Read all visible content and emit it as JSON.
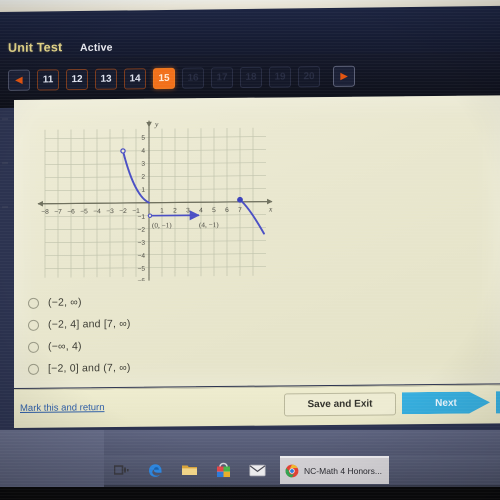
{
  "header": {
    "title": "Unit Test",
    "status": "Active",
    "prev_icon": "left-arrow-icon",
    "next_icon": "right-arrow-icon",
    "pager": [
      {
        "label": "11",
        "state": "normal"
      },
      {
        "label": "12",
        "state": "normal"
      },
      {
        "label": "13",
        "state": "normal"
      },
      {
        "label": "14",
        "state": "normal"
      },
      {
        "label": "15",
        "state": "current"
      },
      {
        "label": "16",
        "state": "disabled"
      },
      {
        "label": "17",
        "state": "disabled"
      },
      {
        "label": "18",
        "state": "disabled"
      },
      {
        "label": "19",
        "state": "disabled"
      },
      {
        "label": "20",
        "state": "disabled"
      }
    ],
    "colors": {
      "title": "#e8d98a",
      "current_button": "#f2701a",
      "button_border": "#7a3a1c",
      "background": "#161c33"
    }
  },
  "chart_data": {
    "type": "line",
    "title": "",
    "xlabel": "x",
    "ylabel": "y",
    "xlim": [
      -8.6,
      8.0
    ],
    "ylim": [
      -6.5,
      5.6
    ],
    "xticks": [
      "-8",
      "-7",
      "-6",
      "-5",
      "-4",
      "-3",
      "-2",
      "-1",
      "1",
      "2",
      "3",
      "4",
      "5",
      "6",
      "7"
    ],
    "yticks": [
      "5",
      "4",
      "3",
      "2",
      "1",
      "-1",
      "-2",
      "-3",
      "-4",
      "-5",
      "-6"
    ],
    "grid": true,
    "curve_color": "#4a4fc4",
    "grid_color": "#b9bda6",
    "axis_color": "#6f705e",
    "series": [
      {
        "name": "branch-left-decreasing",
        "points": [
          [
            -2,
            4
          ],
          [
            -1.6,
            3.0
          ],
          [
            -1.2,
            2.1
          ],
          [
            -0.85,
            1.3
          ],
          [
            -0.5,
            0.6
          ],
          [
            -0.2,
            0.18
          ],
          [
            0,
            0.05
          ]
        ],
        "start_marker": "open-circle",
        "end_marker": "none"
      },
      {
        "name": "constant-segment",
        "points": [
          [
            0,
            -1
          ],
          [
            4,
            -1
          ]
        ],
        "start_marker": "open-circle",
        "end_marker": "closed-arrow"
      },
      {
        "name": "branch-right-decreasing",
        "points": [
          [
            7,
            0
          ],
          [
            7.3,
            -0.5
          ],
          [
            7.6,
            -1.3
          ],
          [
            7.85,
            -2.1
          ],
          [
            8.0,
            -2.6
          ]
        ],
        "start_marker": "closed-dot",
        "end_marker": "none"
      }
    ],
    "annotations": [
      {
        "text": "(0, −1)",
        "x": 0.1,
        "y": -1.9
      },
      {
        "text": "(4, −1)",
        "x": 4.0,
        "y": -1.9
      }
    ]
  },
  "question": {
    "choices": [
      {
        "label": "(−2, ∞)",
        "selected": false
      },
      {
        "label": "(−2, 4] and [7, ∞)",
        "selected": false
      },
      {
        "label": "(−∞, 4)",
        "selected": false
      },
      {
        "label": "[−2, 0] and (7, ∞)",
        "selected": false
      }
    ]
  },
  "footer": {
    "mark_link": "Mark this and return",
    "save_label": "Save and Exit",
    "next_label": "Next",
    "next_color": "#36aede"
  },
  "taskbar": {
    "icons": [
      {
        "name": "task-view-icon"
      },
      {
        "name": "edge-browser-icon"
      },
      {
        "name": "file-explorer-icon"
      },
      {
        "name": "microsoft-store-icon"
      },
      {
        "name": "mail-icon"
      }
    ],
    "open_window": {
      "icon": "chrome-icon",
      "label": "NC-Math 4 Honors..."
    }
  }
}
